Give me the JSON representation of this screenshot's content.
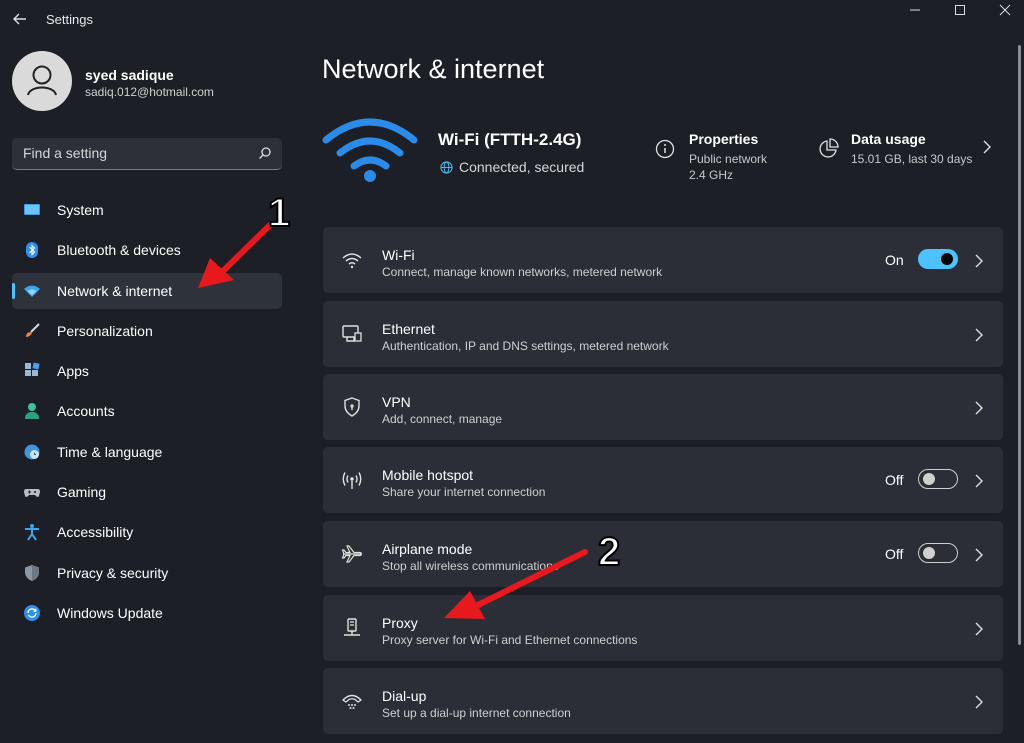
{
  "window": {
    "title": "Settings"
  },
  "user": {
    "name": "syed sadique",
    "email": "sadiq.012@hotmail.com"
  },
  "search": {
    "placeholder": "Find a setting"
  },
  "sidebar": {
    "items": [
      {
        "label": "System",
        "icon": "system-icon"
      },
      {
        "label": "Bluetooth & devices",
        "icon": "bluetooth-icon"
      },
      {
        "label": "Network & internet",
        "icon": "wifi-icon",
        "active": true
      },
      {
        "label": "Personalization",
        "icon": "brush-icon"
      },
      {
        "label": "Apps",
        "icon": "apps-icon"
      },
      {
        "label": "Accounts",
        "icon": "person-icon"
      },
      {
        "label": "Time & language",
        "icon": "clock-globe-icon"
      },
      {
        "label": "Gaming",
        "icon": "gamepad-icon"
      },
      {
        "label": "Accessibility",
        "icon": "accessibility-icon"
      },
      {
        "label": "Privacy & security",
        "icon": "shield-icon"
      },
      {
        "label": "Windows Update",
        "icon": "update-icon"
      }
    ]
  },
  "main": {
    "title": "Network & internet",
    "network": {
      "name": "Wi-Fi (FTTH-2.4G)",
      "status": "Connected, secured"
    },
    "properties": {
      "title": "Properties",
      "line1": "Public network",
      "line2": "2.4 GHz"
    },
    "data_usage": {
      "title": "Data usage",
      "line1": "15.01 GB, last 30 days"
    },
    "cards": [
      {
        "title": "Wi-Fi",
        "desc": "Connect, manage known networks, metered network",
        "toggle": "On"
      },
      {
        "title": "Ethernet",
        "desc": "Authentication, IP and DNS settings, metered network"
      },
      {
        "title": "VPN",
        "desc": "Add, connect, manage"
      },
      {
        "title": "Mobile hotspot",
        "desc": "Share your internet connection",
        "toggle": "Off"
      },
      {
        "title": "Airplane mode",
        "desc": "Stop all wireless communications",
        "toggle": "Off"
      },
      {
        "title": "Proxy",
        "desc": "Proxy server for Wi-Fi and Ethernet connections"
      },
      {
        "title": "Dial-up",
        "desc": "Set up a dial-up internet connection"
      }
    ]
  },
  "annotations": {
    "step1": "1",
    "step2": "2"
  },
  "colors": {
    "accent": "#4cc2ff",
    "arrow": "#e8191c",
    "background": "#1c1f26",
    "card": "#2b2e36"
  }
}
